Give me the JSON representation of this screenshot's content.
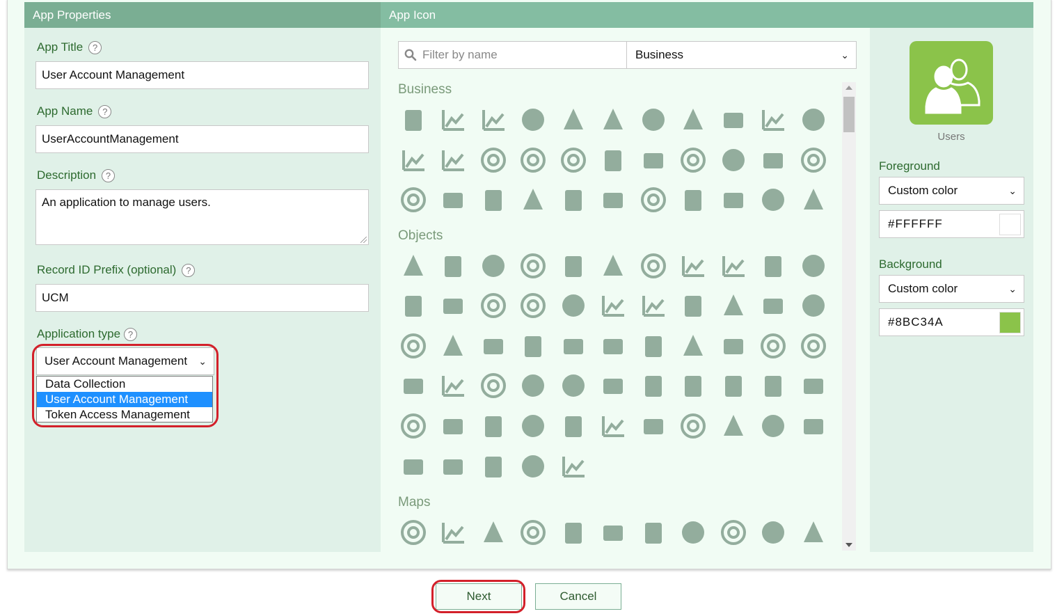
{
  "left_panel": {
    "title": "App Properties",
    "app_title": {
      "label": "App Title",
      "value": "User Account Management",
      "help": "?"
    },
    "app_name": {
      "label": "App Name",
      "value": "UserAccountManagement",
      "help": "?"
    },
    "description": {
      "label": "Description",
      "value": "An application to manage users.",
      "help": "?"
    },
    "record_prefix": {
      "label": "Record ID Prefix (optional)",
      "value": "UCM",
      "help": "?"
    },
    "app_type": {
      "label": "Application type",
      "help": "?",
      "value": "User Account Management",
      "options": [
        "Data Collection",
        "User Account Management",
        "Token Access Management"
      ],
      "selected_index": 1
    }
  },
  "icon_panel": {
    "title": "App Icon",
    "filter_placeholder": "Filter by name",
    "category_select": "Business",
    "categories": [
      {
        "name": "Business",
        "icons": [
          "bullseye-icon",
          "clipboard-check-icon",
          "clipboard-list-icon",
          "address-book-icon",
          "address-book-outline-icon",
          "id-card-icon",
          "id-card-outline-icon",
          "award-icon",
          "briefcase-icon",
          "business-time-icon",
          "certificate-icon",
          "area-chart-icon",
          "bar-chart-icon",
          "bar-chart-outline-icon",
          "line-chart-icon",
          "pie-chart-icon",
          "copyright-icon",
          "copyright-outline-icon",
          "envelope-open-text-icon",
          "funnel-dollar-icon",
          "industry-icon",
          "mail-bulk-icon",
          "percent-icon",
          "poll-icon",
          "poll-h-icon",
          "project-diagram-icon",
          "registered-icon",
          "registered-outline-icon",
          "search-dollar-icon",
          "sitemap-icon",
          "trademark-icon",
          "wallet-icon",
          "ad-icon"
        ]
      },
      {
        "name": "Objects",
        "icons": [
          "anchor-icon",
          "baby-carriage-icon",
          "balance-scale-icon",
          "bath-icon",
          "binoculars-icon",
          "birthday-cake-icon",
          "blender-icon",
          "box-icon",
          "box-open-icon",
          "boxes-icon",
          "broom-icon",
          "bullhorn-icon",
          "coffee-mug-icon",
          "couch-icon",
          "cube-icon",
          "cubes-icon",
          "credit-card-icon",
          "drum-icon",
          "drum-steelpan-icon",
          "fire-icon",
          "fire-alt-icon",
          "fire-extinguisher-icon",
          "gamepad-icon",
          "gavel-icon",
          "gem-icon",
          "gem-outline-icon",
          "glasses-icon",
          "guitar-icon",
          "hard-hat-icon",
          "holly-berry-icon",
          "key-icon",
          "leaf-icon",
          "life-ring-icon",
          "life-ring-outline-icon",
          "lightbulb-icon",
          "lightbulb-outline-icon",
          "magnet-icon",
          "medal-icon",
          "mitten-icon",
          "mountain-icon",
          "mug-hot-icon",
          "pallet-icon",
          "paper-plane-icon",
          "paper-plane-outline-icon",
          "parachute-box-icon",
          "plug-icon",
          "puzzle-piece-icon",
          "ribbon-icon",
          "ring-icon",
          "screwdriver-icon",
          "socks-icon",
          "shower-icon",
          "tape-icon",
          "toilet-icon",
          "toolbox-icon",
          "tools-icon",
          "tree-icon",
          "trophy-icon",
          "weight-icon",
          "wrench-icon"
        ]
      },
      {
        "name": "Maps",
        "icons": [
          "compass-icon",
          "compass-outline-icon",
          "crosshairs-icon",
          "directions-icon",
          "flag-icon",
          "flag-outline-icon",
          "flag-checkered-icon",
          "flag-usa-icon",
          "globe-icon",
          "globe-africa-icon",
          "globe-americas-icon"
        ]
      }
    ]
  },
  "preview": {
    "icon": "users-icon",
    "label": "Users",
    "foreground": {
      "label": "Foreground",
      "mode": "Custom color",
      "value": "#FFFFFF",
      "color": "#FFFFFF"
    },
    "background": {
      "label": "Background",
      "mode": "Custom color",
      "value": "#8BC34A",
      "color": "#8BC34A"
    }
  },
  "buttons": {
    "next": "Next",
    "cancel": "Cancel"
  },
  "colors": {
    "header": "#84bda2",
    "icon_gray": "#93ad9d",
    "highlight": "#d3202a",
    "label_green": "#2d6a2f"
  }
}
